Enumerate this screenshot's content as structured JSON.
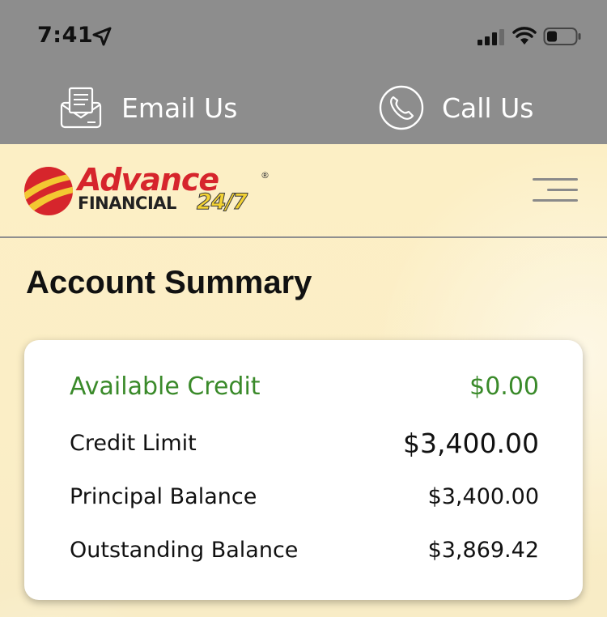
{
  "status_bar": {
    "time": "7:41"
  },
  "contact": {
    "email_label": "Email Us",
    "call_label": "Call Us"
  },
  "brand": {
    "name_top": "Advance",
    "name_bottom": "FINANCIAL",
    "suffix": "24/7",
    "registered": "®",
    "colors": {
      "red": "#d6252c",
      "yellow": "#f3d233"
    }
  },
  "page": {
    "title": "Account Summary"
  },
  "summary": {
    "available_credit_label": "Available Credit",
    "available_credit_value": "$0.00",
    "credit_limit_label": "Credit Limit",
    "credit_limit_value": "$3,400.00",
    "principal_balance_label": "Principal Balance",
    "principal_balance_value": "$3,400.00",
    "outstanding_balance_label": "Outstanding Balance",
    "outstanding_balance_value": "$3,869.42"
  },
  "colors": {
    "top_band": "#8d8d8d",
    "background": "#fcefc7",
    "accent_green": "#3a8a2a"
  }
}
